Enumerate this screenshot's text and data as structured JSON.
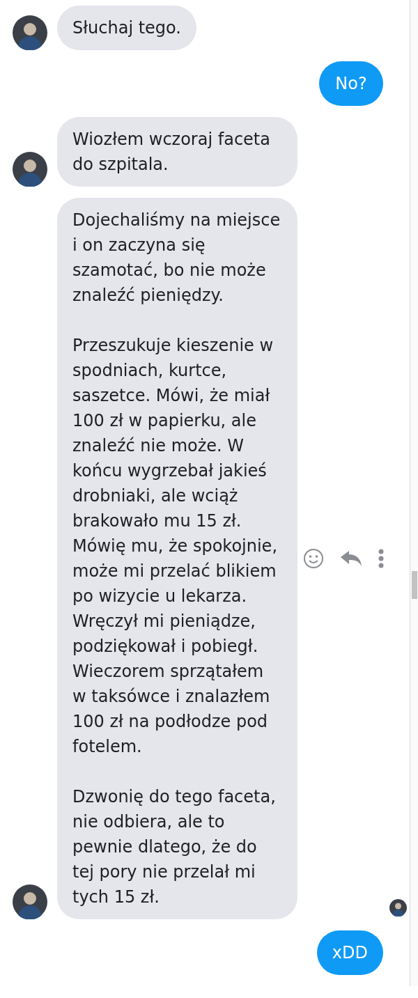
{
  "messages": [
    {
      "kind": "incoming",
      "avatar": true,
      "paragraphs": [
        "Słuchaj tego."
      ]
    },
    {
      "kind": "outgoing",
      "paragraphs": [
        "No?"
      ]
    },
    {
      "kind": "incoming",
      "avatar": true,
      "paragraphs": [
        "Wiozłem wczoraj faceta do szpitala."
      ]
    },
    {
      "kind": "incoming",
      "avatar": true,
      "hover_actions": true,
      "read_receipt": true,
      "paragraphs": [
        "Dojechaliśmy na miejsce i on zaczyna się szamotać, bo nie może znaleźć pieniędzy.",
        "Przeszukuje kieszenie w spodniach, kurtce, saszetce. Mówi, że miał 100 zł w papierku, ale znaleźć nie może. W końcu wygrzebał jakieś drobniaki, ale wciąż brakowało mu 15 zł. Mówię mu, że spokojnie, może mi przelać blikiem po wizycie u lekarza. Wręczył mi pieniądze, podziękował i pobiegł. Wieczorem sprzątałem w taksówce i znalazłem 100 zł na podłodze pod fotelem.",
        "Dzwonię do tego faceta, nie odbiera, ale to pewnie dlatego, że do tej pory nie przelał mi tych 15 zł."
      ]
    },
    {
      "kind": "outgoing",
      "paragraphs": [
        "xDD"
      ]
    }
  ]
}
